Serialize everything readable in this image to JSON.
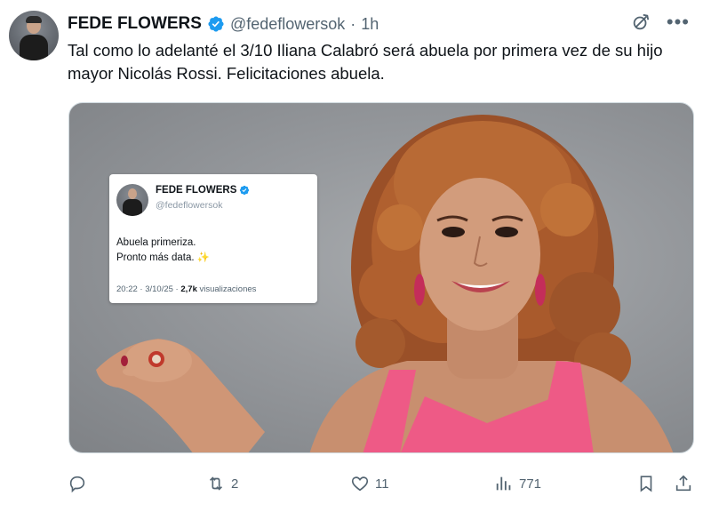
{
  "tweet": {
    "author_name": "FEDE FLOWERS",
    "handle": "@fedeflowersok",
    "separator": "·",
    "time": "1h",
    "text": "Tal como lo adelanté el 3/10 Iliana Calabró será abuela por primera vez de su hijo mayor Nicolás Rossi. Felicitaciones abuela."
  },
  "embedded_tweet": {
    "author_name": "FEDE FLOWERS",
    "handle": "@fedeflowersok",
    "line1": "Abuela primeriza.",
    "line2": "Pronto más data.",
    "sparkle": "✨",
    "date_time": "20:22 · 3/10/25 · ",
    "views": "2,7k",
    "views_label": " visualizaciones"
  },
  "actions": {
    "replies": "",
    "reposts": "2",
    "likes": "11",
    "views": "771"
  },
  "icons": {
    "verified": "verified-badge-icon",
    "grok": "grok-icon",
    "more": "more-icon",
    "reply": "reply-icon",
    "repost": "repost-icon",
    "like": "heart-icon",
    "views": "views-icon",
    "bookmark": "bookmark-icon",
    "share": "share-icon"
  },
  "colors": {
    "verified_blue": "#1d9bf0",
    "text_primary": "#0f1419",
    "text_secondary": "#536471",
    "dress_pink": "#ee5a86",
    "hair": "#b0602f"
  }
}
